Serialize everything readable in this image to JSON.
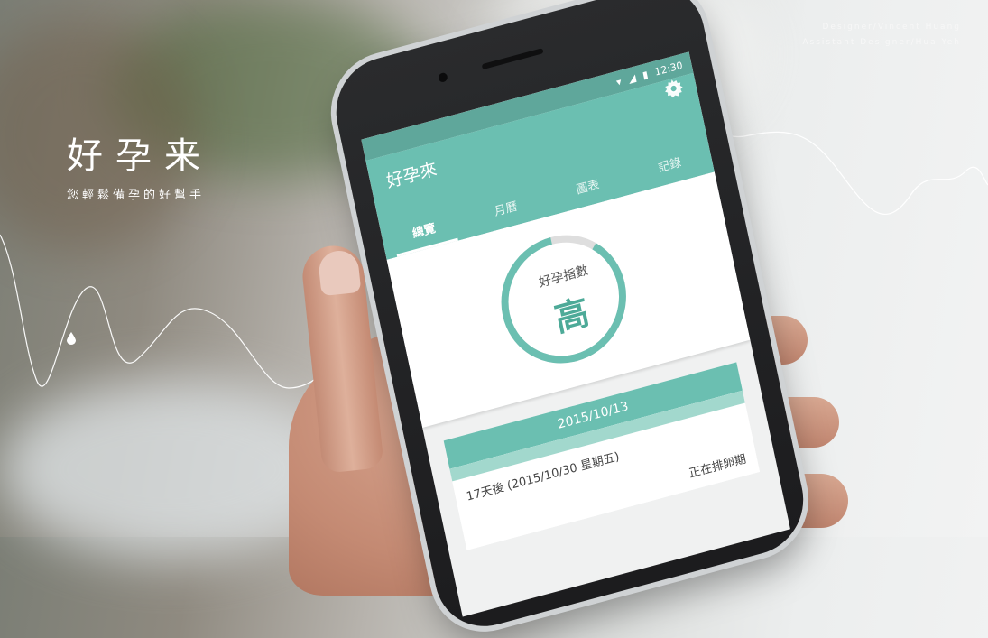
{
  "credits": {
    "designer": "Designer/Vincent Huang",
    "assistant": "Assistant Designer/Hua Yeh"
  },
  "brand": {
    "title": "好孕来",
    "subtitle": "您輕鬆備孕的好幫手"
  },
  "phone": {
    "status_time": "12:30",
    "app_title": "好孕來",
    "tabs": [
      {
        "label": "總覽",
        "active": true
      },
      {
        "label": "月曆",
        "active": false
      },
      {
        "label": "圖表",
        "active": false
      },
      {
        "label": "記錄",
        "active": false
      }
    ],
    "index_label": "好孕指數",
    "index_value": "高",
    "index_progress": 0.88,
    "card": {
      "date": "2015/10/13",
      "countdown": "17天後 (2015/10/30 星期五)",
      "status": "正在排卵期"
    }
  },
  "colors": {
    "accent": "#6bbfb1",
    "accent_dark": "#4daa98",
    "status_bar": "#5fa79b"
  },
  "icons": [
    "drop-icon",
    "wifi-icon",
    "signal-icon",
    "battery-icon",
    "gear-icon"
  ]
}
